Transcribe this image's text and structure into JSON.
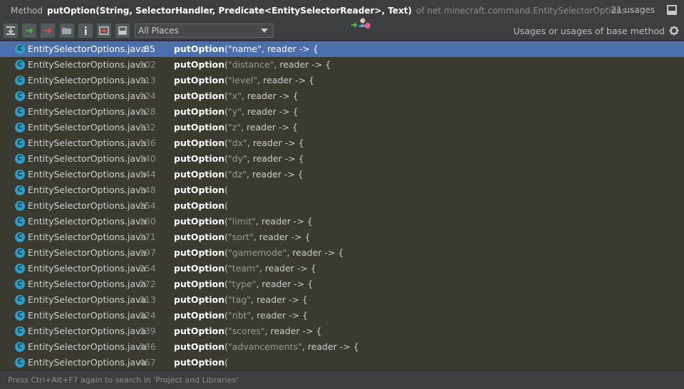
{
  "title": {
    "prefix": "Method",
    "signature": "putOption(String, SelectorHandler, Predicate<EntitySelectorReader>, Text)",
    "suffix": "of net.minecraft.command.EntitySelectorOptions",
    "usage_count": "21 usages"
  },
  "toolbar": {
    "scope_value": "All Places",
    "filter_label": "Usages or usages of base method",
    "icons": [
      "expand-all-icon",
      "navigate-forward-icon",
      "navigate-back-icon",
      "open-folder-icon",
      "info-icon",
      "preview-icon",
      "toggle-panel-icon",
      "settings-gear-icon"
    ]
  },
  "rows": [
    {
      "file": "EntitySelectorOptions.java",
      "line": "85",
      "method": "putOption",
      "arg": "\"name\"",
      "rest": ", reader -> {",
      "selected": true
    },
    {
      "file": "EntitySelectorOptions.java",
      "line": "102",
      "method": "putOption",
      "arg": "\"distance\"",
      "rest": ", reader -> {"
    },
    {
      "file": "EntitySelectorOptions.java",
      "line": "113",
      "method": "putOption",
      "arg": "\"level\"",
      "rest": ", reader -> {"
    },
    {
      "file": "EntitySelectorOptions.java",
      "line": "124",
      "method": "putOption",
      "arg": "\"x\"",
      "rest": ", reader -> {"
    },
    {
      "file": "EntitySelectorOptions.java",
      "line": "128",
      "method": "putOption",
      "arg": "\"y\"",
      "rest": ", reader -> {"
    },
    {
      "file": "EntitySelectorOptions.java",
      "line": "132",
      "method": "putOption",
      "arg": "\"z\"",
      "rest": ", reader -> {"
    },
    {
      "file": "EntitySelectorOptions.java",
      "line": "136",
      "method": "putOption",
      "arg": "\"dx\"",
      "rest": ", reader -> {"
    },
    {
      "file": "EntitySelectorOptions.java",
      "line": "140",
      "method": "putOption",
      "arg": "\"dy\"",
      "rest": ", reader -> {"
    },
    {
      "file": "EntitySelectorOptions.java",
      "line": "144",
      "method": "putOption",
      "arg": "\"dz\"",
      "rest": ", reader -> {"
    },
    {
      "file": "EntitySelectorOptions.java",
      "line": "148",
      "method": "putOption",
      "arg": "",
      "rest": ""
    },
    {
      "file": "EntitySelectorOptions.java",
      "line": "154",
      "method": "putOption",
      "arg": "",
      "rest": ""
    },
    {
      "file": "EntitySelectorOptions.java",
      "line": "160",
      "method": "putOption",
      "arg": "\"limit\"",
      "rest": ", reader -> {"
    },
    {
      "file": "EntitySelectorOptions.java",
      "line": "171",
      "method": "putOption",
      "arg": "\"sort\"",
      "rest": ", reader -> {"
    },
    {
      "file": "EntitySelectorOptions.java",
      "line": "197",
      "method": "putOption",
      "arg": "\"gamemode\"",
      "rest": ", reader -> {"
    },
    {
      "file": "EntitySelectorOptions.java",
      "line": "254",
      "method": "putOption",
      "arg": "\"team\"",
      "rest": ", reader -> {"
    },
    {
      "file": "EntitySelectorOptions.java",
      "line": "272",
      "method": "putOption",
      "arg": "\"type\"",
      "rest": ", reader -> {"
    },
    {
      "file": "EntitySelectorOptions.java",
      "line": "313",
      "method": "putOption",
      "arg": "\"tag\"",
      "rest": ", reader -> {"
    },
    {
      "file": "EntitySelectorOptions.java",
      "line": "324",
      "method": "putOption",
      "arg": "\"nbt\"",
      "rest": ", reader -> {"
    },
    {
      "file": "EntitySelectorOptions.java",
      "line": "339",
      "method": "putOption",
      "arg": "\"scores\"",
      "rest": ", reader -> {"
    },
    {
      "file": "EntitySelectorOptions.java",
      "line": "386",
      "method": "putOption",
      "arg": "\"advancements\"",
      "rest": ", reader -> {"
    },
    {
      "file": "EntitySelectorOptions.java",
      "line": "467",
      "method": "putOption",
      "arg": "",
      "rest": ""
    }
  ],
  "status": {
    "hint": "Press Ctrl+Alt+F7 again to search in 'Project and Libraries'"
  },
  "colors": {
    "selection": "#4b6eaf",
    "list_background": "#3a3a30",
    "panel_background": "#3c3f41",
    "class_icon": "#2a9ec8"
  }
}
